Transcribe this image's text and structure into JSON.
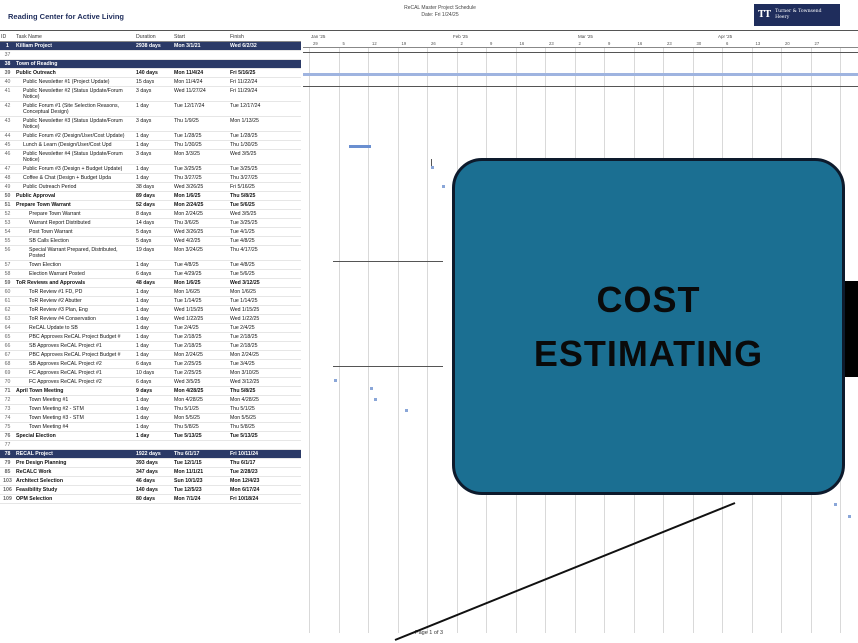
{
  "header": {
    "title": "Reading Center for Active Living",
    "schedule_title": "ReCAL Master Project Schedule",
    "schedule_date": "Date: Fri 1/24/25",
    "logo_mark": "TT",
    "logo_line1": "Turner & Townsend",
    "logo_line2": "Heery"
  },
  "columns": {
    "id": "ID",
    "task": "Task Name",
    "duration": "Duration",
    "start": "Start",
    "finish": "Finish"
  },
  "timeline": {
    "months": [
      "Jan '25",
      "Feb '25",
      "Mar '25",
      "Apr '25"
    ],
    "weeks": [
      "29",
      "5",
      "12",
      "19",
      "26",
      "2",
      "9",
      "16",
      "23",
      "2",
      "9",
      "16",
      "23",
      "30",
      "6",
      "13",
      "20",
      "27"
    ]
  },
  "rows": [
    {
      "id": "1",
      "task": "Killiam Project",
      "duration": "2938 days",
      "start": "Mon 3/1/21",
      "finish": "Wed 6/2/32",
      "style": "band"
    },
    {
      "id": "37",
      "task": "",
      "duration": "",
      "start": "",
      "finish": "",
      "style": ""
    },
    {
      "id": "38",
      "task": "Town of Reading",
      "duration": "",
      "start": "",
      "finish": "",
      "style": "band"
    },
    {
      "id": "39",
      "task": "Public Outreach",
      "duration": "140 days",
      "start": "Mon 11/4/24",
      "finish": "Fri 5/16/25",
      "style": "summary"
    },
    {
      "id": "40",
      "task": "Public Newsletter #1 (Project Update)",
      "duration": "15 days",
      "start": "Mon 11/4/24",
      "finish": "Fri 11/22/24",
      "style": ""
    },
    {
      "id": "41",
      "task": "Public Newsletter #2 (Status Update/Forum Notice)",
      "duration": "3 days",
      "start": "Wed 11/27/24",
      "finish": "Fri 11/29/24",
      "style": "wrap"
    },
    {
      "id": "42",
      "task": "Public Forum #1 (Site Selection Reasons, Conceptual Design)",
      "duration": "1 day",
      "start": "Tue 12/17/24",
      "finish": "Tue 12/17/24",
      "style": "wrap"
    },
    {
      "id": "43",
      "task": "Public Newsletter #3 (Status Update/Forum Notice)",
      "duration": "3 days",
      "start": "Thu 1/9/25",
      "finish": "Mon 1/13/25",
      "style": "wrap"
    },
    {
      "id": "44",
      "task": "Public Forum #2 (Design/User/Cost Update)",
      "duration": "1 day",
      "start": "Tue 1/28/25",
      "finish": "Tue 1/28/25",
      "style": "wrap"
    },
    {
      "id": "45",
      "task": "Lunch & Learn (Design/User/Cost Upd",
      "duration": "1 day",
      "start": "Thu 1/30/25",
      "finish": "Thu 1/30/25",
      "style": ""
    },
    {
      "id": "46",
      "task": "Public Newsletter #4 (Status Update/Forum Notice)",
      "duration": "3 days",
      "start": "Mon 3/3/25",
      "finish": "Wed 3/5/25",
      "style": "wrap"
    },
    {
      "id": "47",
      "task": "Public Forum #3 (Design + Budget Update)",
      "duration": "1 day",
      "start": "Tue 3/25/25",
      "finish": "Tue 3/25/25",
      "style": "wrap"
    },
    {
      "id": "48",
      "task": "Coffee & Chat (Design + Budget Upda",
      "duration": "1 day",
      "start": "Thu 3/27/25",
      "finish": "Thu 3/27/25",
      "style": ""
    },
    {
      "id": "49",
      "task": "Public Outreach Period",
      "duration": "38 days",
      "start": "Wed 3/26/25",
      "finish": "Fri 5/16/25",
      "style": ""
    },
    {
      "id": "50",
      "task": "Public Approval",
      "duration": "89 days",
      "start": "Mon 1/6/25",
      "finish": "Thu 5/8/25",
      "style": "summary"
    },
    {
      "id": "51",
      "task": "Prepare Town Warrant",
      "duration": "52 days",
      "start": "Mon 2/24/25",
      "finish": "Tue 5/6/25",
      "style": "summary"
    },
    {
      "id": "52",
      "task": "Prepare Town Warrant",
      "duration": "8 days",
      "start": "Mon 2/24/25",
      "finish": "Wed 3/5/25",
      "style": ""
    },
    {
      "id": "53",
      "task": "Warrant Report Distributed",
      "duration": "14 days",
      "start": "Thu 3/6/25",
      "finish": "Tue 3/25/25",
      "style": ""
    },
    {
      "id": "54",
      "task": "Post Town Warrant",
      "duration": "5 days",
      "start": "Wed 3/26/25",
      "finish": "Tue 4/1/25",
      "style": ""
    },
    {
      "id": "55",
      "task": "SB Calls Election",
      "duration": "5 days",
      "start": "Wed 4/2/25",
      "finish": "Tue 4/8/25",
      "style": ""
    },
    {
      "id": "56",
      "task": "Special Warrant Prepared, Distributed, Posted",
      "duration": "19 days",
      "start": "Mon 3/24/25",
      "finish": "Thu 4/17/25",
      "style": "wrap"
    },
    {
      "id": "57",
      "task": "Town Election",
      "duration": "1 day",
      "start": "Tue 4/8/25",
      "finish": "Tue 4/8/25",
      "style": ""
    },
    {
      "id": "58",
      "task": "Election Warrant Posted",
      "duration": "6 days",
      "start": "Tue 4/29/25",
      "finish": "Tue 5/6/25",
      "style": ""
    },
    {
      "id": "59",
      "task": "ToR Reviews and Approvals",
      "duration": "48 days",
      "start": "Mon 1/6/25",
      "finish": "Wed 3/12/25",
      "style": "summary"
    },
    {
      "id": "60",
      "task": "ToR Review #1 FD, PD",
      "duration": "1 day",
      "start": "Mon 1/6/25",
      "finish": "Mon 1/6/25",
      "style": ""
    },
    {
      "id": "61",
      "task": "ToR Review #2 Abutter",
      "duration": "1 day",
      "start": "Tue 1/14/25",
      "finish": "Tue 1/14/25",
      "style": ""
    },
    {
      "id": "62",
      "task": "ToR Review #3 Plan, Eng",
      "duration": "1 day",
      "start": "Wed 1/15/25",
      "finish": "Wed 1/15/25",
      "style": ""
    },
    {
      "id": "63",
      "task": "ToR Review #4 Conservation",
      "duration": "1 day",
      "start": "Wed 1/22/25",
      "finish": "Wed 1/22/25",
      "style": ""
    },
    {
      "id": "64",
      "task": "ReCAL Update to SB",
      "duration": "1 day",
      "start": "Tue 2/4/25",
      "finish": "Tue 2/4/25",
      "style": ""
    },
    {
      "id": "65",
      "task": "PBC Approves ReCAL Project Budget #",
      "duration": "1 day",
      "start": "Tue 2/18/25",
      "finish": "Tue 2/18/25",
      "style": ""
    },
    {
      "id": "66",
      "task": "SB Approves ReCAL Project #1",
      "duration": "1 day",
      "start": "Tue 2/18/25",
      "finish": "Tue 2/18/25",
      "style": ""
    },
    {
      "id": "67",
      "task": "PBC Approves ReCAL Project Budget #",
      "duration": "1 day",
      "start": "Mon 2/24/25",
      "finish": "Mon 2/24/25",
      "style": ""
    },
    {
      "id": "68",
      "task": "SB Approves ReCAL Project #2",
      "duration": "6 days",
      "start": "Tue 2/25/25",
      "finish": "Tue 3/4/25",
      "style": ""
    },
    {
      "id": "69",
      "task": "FC Approves ReCAL Project #1",
      "duration": "10 days",
      "start": "Tue 2/25/25",
      "finish": "Mon 3/10/25",
      "style": ""
    },
    {
      "id": "70",
      "task": "FC Approves ReCAL Project #2",
      "duration": "6 days",
      "start": "Wed 3/5/25",
      "finish": "Wed 3/12/25",
      "style": ""
    },
    {
      "id": "71",
      "task": "April Town Meeting",
      "duration": "9 days",
      "start": "Mon 4/28/25",
      "finish": "Thu 5/8/25",
      "style": "summary"
    },
    {
      "id": "72",
      "task": "Town Meeting #1",
      "duration": "1 day",
      "start": "Mon 4/28/25",
      "finish": "Mon 4/28/25",
      "style": ""
    },
    {
      "id": "73",
      "task": "Town Meeting #2 - STM",
      "duration": "1 day",
      "start": "Thu 5/1/25",
      "finish": "Thu 5/1/25",
      "style": ""
    },
    {
      "id": "74",
      "task": "Town Meeting #3 - STM",
      "duration": "1 day",
      "start": "Mon 5/5/25",
      "finish": "Mon 5/5/25",
      "style": ""
    },
    {
      "id": "75",
      "task": "Town Meeting #4",
      "duration": "1 day",
      "start": "Thu 5/8/25",
      "finish": "Thu 5/8/25",
      "style": ""
    },
    {
      "id": "76",
      "task": "Special Election",
      "duration": "1 day",
      "start": "Tue 5/13/25",
      "finish": "Tue 5/13/25",
      "style": "summary"
    },
    {
      "id": "77",
      "task": "",
      "duration": "",
      "start": "",
      "finish": "",
      "style": ""
    },
    {
      "id": "78",
      "task": "RECAL Project",
      "duration": "1922 days",
      "start": "Thu 6/1/17",
      "finish": "Fri 10/11/24",
      "style": "band"
    },
    {
      "id": "79",
      "task": "Pre Design Planning",
      "duration": "393 days",
      "start": "Tue 12/1/15",
      "finish": "Thu 6/1/17",
      "style": "summary"
    },
    {
      "id": "85",
      "task": "ReCALC Work",
      "duration": "347 days",
      "start": "Mon 11/1/21",
      "finish": "Tue 2/28/23",
      "style": "summary"
    },
    {
      "id": "103",
      "task": "Architect Selection",
      "duration": "46 days",
      "start": "Sun 10/1/23",
      "finish": "Mon 12/4/23",
      "style": "summary"
    },
    {
      "id": "106",
      "task": "Feasibility Study",
      "duration": "140 days",
      "start": "Tue 12/5/23",
      "finish": "Mon 6/17/24",
      "style": "summary"
    },
    {
      "id": "109",
      "task": "OPM Selection",
      "duration": "80 days",
      "start": "Mon 7/1/24",
      "finish": "Fri 10/18/24",
      "style": "summary"
    }
  ],
  "footer": {
    "page": "Page 1 of 3"
  },
  "callout": {
    "line1": "COST",
    "line2": "ESTIMATING",
    "fill": "#1b6f92",
    "border": "#0d1a2c"
  }
}
